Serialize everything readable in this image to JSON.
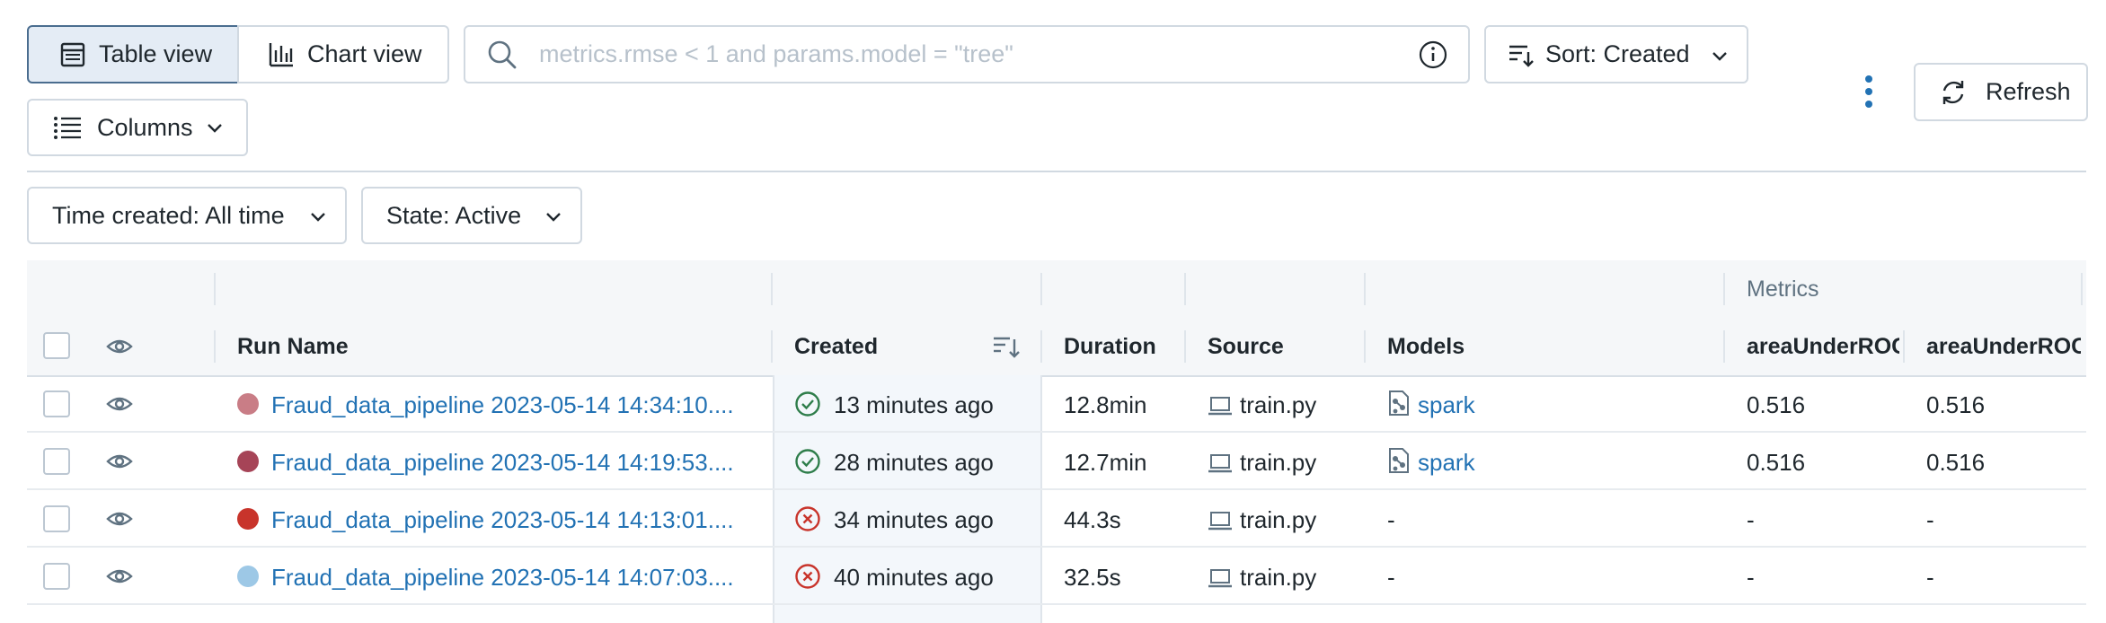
{
  "toolbar": {
    "table_view_label": "Table view",
    "chart_view_label": "Chart view",
    "search_placeholder": "metrics.rmse < 1 and params.model = \"tree\"",
    "sort_label": "Sort: Created",
    "refresh_label": "Refresh",
    "columns_label": "Columns"
  },
  "filters": {
    "time_created_label": "Time created: All time",
    "state_label": "State: Active"
  },
  "table": {
    "group_header": "Metrics",
    "columns": [
      "Run Name",
      "Created",
      "Duration",
      "Source",
      "Models",
      "areaUnderROC",
      "areaUnderROC"
    ],
    "rows": [
      {
        "run_name": "Fraud_data_pipeline 2023-05-14 14:34:10....",
        "dot_color": "#c97d86",
        "status": "success",
        "created": "13 minutes ago",
        "duration": "12.8min",
        "source": "train.py",
        "model": "spark",
        "m1": "0.516",
        "m2": "0.516"
      },
      {
        "run_name": "Fraud_data_pipeline 2023-05-14 14:19:53....",
        "dot_color": "#a64457",
        "status": "success",
        "created": "28 minutes ago",
        "duration": "12.7min",
        "source": "train.py",
        "model": "spark",
        "m1": "0.516",
        "m2": "0.516"
      },
      {
        "run_name": "Fraud_data_pipeline 2023-05-14 14:13:01....",
        "dot_color": "#c8342b",
        "status": "failed",
        "created": "34 minutes ago",
        "duration": "44.3s",
        "source": "train.py",
        "model": "-",
        "m1": "-",
        "m2": "-"
      },
      {
        "run_name": "Fraud_data_pipeline 2023-05-14 14:07:03....",
        "dot_color": "#9dc8e6",
        "status": "failed",
        "created": "40 minutes ago",
        "duration": "32.5s",
        "source": "train.py",
        "model": "-",
        "m1": "-",
        "m2": "-"
      }
    ]
  },
  "colors": {
    "success": "#2e7d4a",
    "failed": "#c8342b",
    "link": "#2272b4",
    "accent": "#4a6d8f"
  }
}
